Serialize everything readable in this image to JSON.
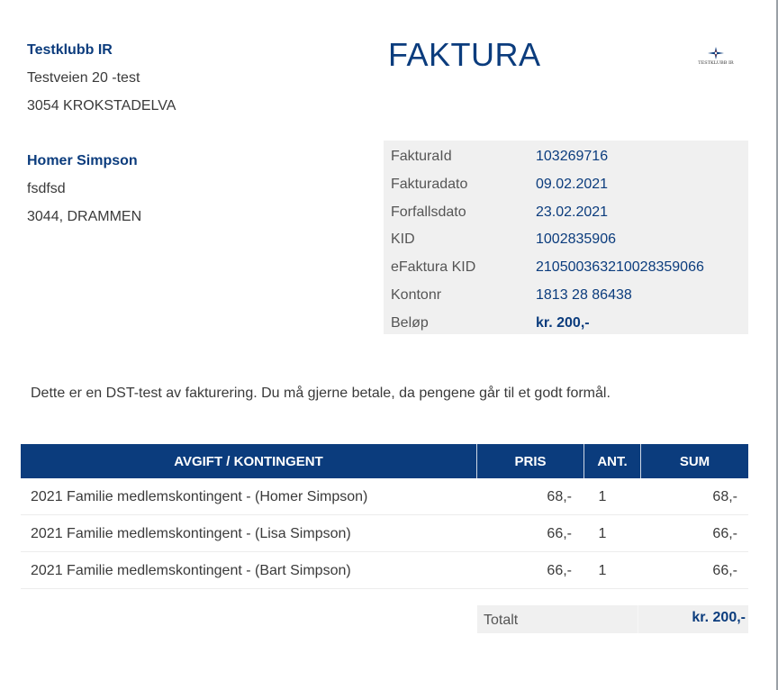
{
  "sender": {
    "name": "Testklubb IR",
    "address": "Testveien 20 -test",
    "postal": "3054 KROKSTADELVA"
  },
  "title": "FAKTURA",
  "logo": {
    "icon": "compass-star-icon",
    "text": "TESTKLUBB IR"
  },
  "recipient": {
    "name": "Homer Simpson",
    "address": "fsdfsd",
    "postal": "3044, DRAMMEN"
  },
  "invoice_info": [
    {
      "label": "FakturaId",
      "value": "103269716"
    },
    {
      "label": "Fakturadato",
      "value": "09.02.2021"
    },
    {
      "label": "Forfallsdato",
      "value": "23.02.2021"
    },
    {
      "label": "KID",
      "value": "1002835906"
    },
    {
      "label": "eFaktura KID",
      "value": "210500363210028359066"
    },
    {
      "label": "Kontonr",
      "value": "1813 28 86438"
    },
    {
      "label": "Beløp",
      "value": "kr. 200,-"
    }
  ],
  "message": "Dette er en DST-test av fakturering. Du må gjerne betale, da pengene går til et godt formål.",
  "table": {
    "headers": {
      "description": "AVGIFT / KONTINGENT",
      "price": "PRIS",
      "quantity": "ANT.",
      "sum": "SUM"
    },
    "rows": [
      {
        "description": "2021 Familie medlemskontingent -  (Homer Simpson)",
        "price": "68,-",
        "quantity": "1",
        "sum": "68,-"
      },
      {
        "description": "2021 Familie medlemskontingent -  (Lisa Simpson)",
        "price": "66,-",
        "quantity": "1",
        "sum": "66,-"
      },
      {
        "description": "2021 Familie medlemskontingent -  (Bart Simpson)",
        "price": "66,-",
        "quantity": "1",
        "sum": "66,-"
      }
    ]
  },
  "total": {
    "label": "Totalt",
    "value": "kr. 200,-"
  },
  "colors": {
    "brand": "#0b3c7d",
    "panel": "#f0f0f0"
  }
}
